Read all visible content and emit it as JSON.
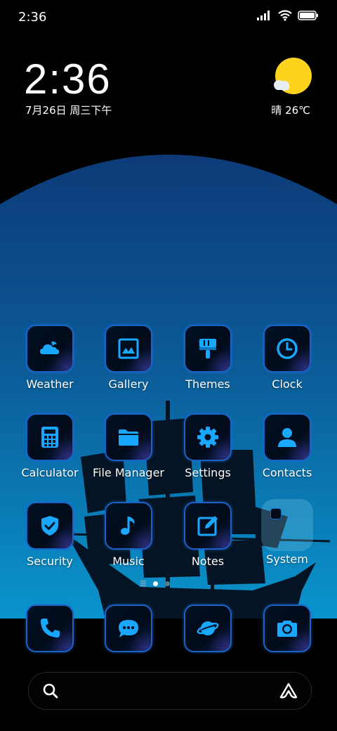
{
  "status_bar": {
    "time": "2:36"
  },
  "lock_widget": {
    "time": "2:36",
    "date": "7月26日 周三下午",
    "weather": "晴 26℃"
  },
  "apps": [
    {
      "label": "Weather",
      "icon": "weather-icon"
    },
    {
      "label": "Gallery",
      "icon": "gallery-icon"
    },
    {
      "label": "Themes",
      "icon": "themes-brush-icon"
    },
    {
      "label": "Clock",
      "icon": "clock-icon"
    },
    {
      "label": "Calculator",
      "icon": "calculator-icon"
    },
    {
      "label": "File Manager",
      "icon": "folder-icon"
    },
    {
      "label": "Settings",
      "icon": "gear-icon"
    },
    {
      "label": "Contacts",
      "icon": "person-icon"
    },
    {
      "label": "Security",
      "icon": "shield-check-icon"
    },
    {
      "label": "Music",
      "icon": "music-note-icon"
    },
    {
      "label": "Notes",
      "icon": "notes-pencil-icon"
    },
    {
      "label": "System",
      "icon": "folder-group-icon"
    }
  ],
  "dock": [
    {
      "icon": "phone-icon"
    },
    {
      "icon": "message-icon"
    },
    {
      "icon": "browser-planet-icon"
    },
    {
      "icon": "camera-icon"
    }
  ],
  "search": {
    "left_icon": "search-icon",
    "right_icon": "assistant-logo-icon"
  },
  "colors": {
    "accent": "#1aa8ff",
    "tile_border": "#1863c4",
    "sun": "#ffd21e"
  }
}
